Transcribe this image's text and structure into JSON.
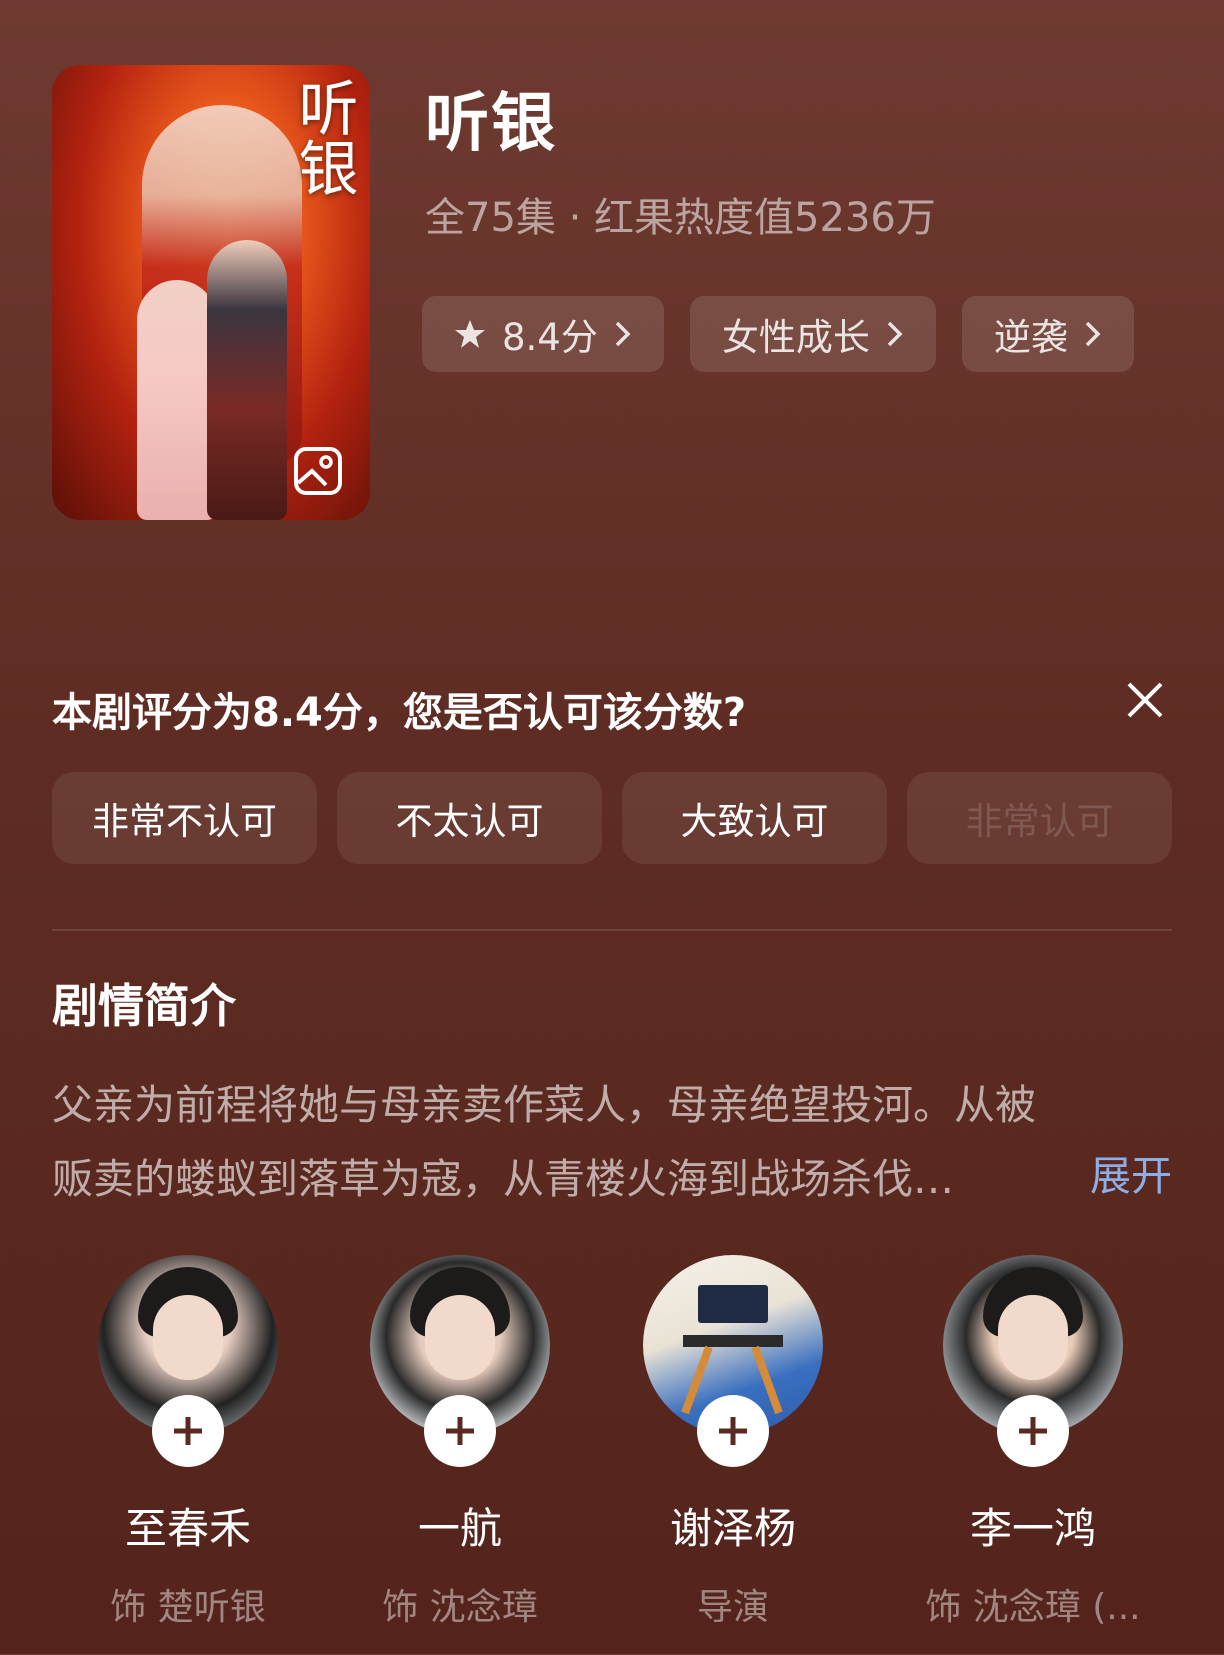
{
  "show": {
    "title": "听银",
    "meta": "全75集 · 红果热度值5236万",
    "poster_title": "听银"
  },
  "tags": [
    {
      "label": "8.4分",
      "icon": "star-icon"
    },
    {
      "label": "女性成长"
    },
    {
      "label": "逆袭"
    }
  ],
  "rating_prompt": {
    "question": "本剧评分为8.4分，您是否认可该分数?",
    "options": [
      "非常不认可",
      "不太认可",
      "大致认可",
      "非常认可"
    ]
  },
  "synopsis": {
    "heading": "剧情简介",
    "line1": "父亲为前程将她与母亲卖作菜人，母亲绝望投河。从被",
    "line2": "贩卖的蝼蚁到落草为寇，从青楼火海到战场杀伐…",
    "expand_label": "展开"
  },
  "cast": [
    {
      "name": "至春禾",
      "role": "饰 楚听银"
    },
    {
      "name": "一航",
      "role": "饰 沈念璋"
    },
    {
      "name": "谢泽杨",
      "role": "导演"
    },
    {
      "name": "李一鸿",
      "role": "饰 沈念璋 (..."
    }
  ],
  "colors": {
    "background": "#5e2c22",
    "link": "#8eaee8"
  }
}
